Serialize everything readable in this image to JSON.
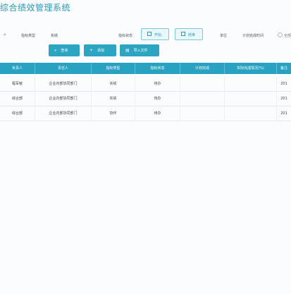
{
  "header": {
    "title": "综合绩效管理系统"
  },
  "filters": {
    "type_label": "指标类型",
    "type_value": "实绩",
    "status_label": "指标状态",
    "start_btn": "开始",
    "end_btn": "结束",
    "unit_label": "单位",
    "plan_time_label": "计划完成时间",
    "radio_label": "全部"
  },
  "actions": {
    "search": "查询",
    "add": "添加",
    "import": "导入文件"
  },
  "table": {
    "columns": [
      "负责人",
      "责任人",
      "指标类型",
      "指标状态",
      "计划完成",
      "实际完成情况(%)",
      "备注"
    ],
    "rows": [
      [
        "程军敏",
        "企业内部协同部门",
        "实绩",
        "待办",
        "",
        "",
        "201"
      ],
      [
        "综合部",
        "企业内部协同部门",
        "实绩",
        "待办",
        "",
        "",
        "201"
      ],
      [
        "综合部",
        "企业内部协同部门",
        "协作",
        "待办",
        "",
        "",
        "201"
      ]
    ]
  }
}
